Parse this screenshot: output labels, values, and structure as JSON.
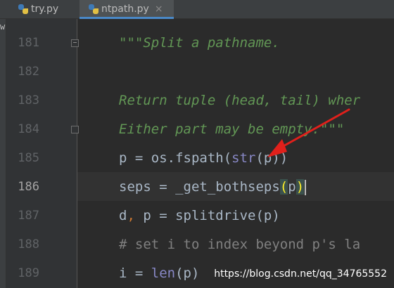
{
  "tabs": [
    {
      "label": "try.py",
      "active": false
    },
    {
      "label": "ntpath.py",
      "active": true,
      "close": "×"
    }
  ],
  "left_strip_label": "w",
  "lines": [
    {
      "num": "181",
      "tokens": [
        {
          "t": "\"\"\"Split a pathname.",
          "c": "doc"
        }
      ]
    },
    {
      "num": "182",
      "tokens": []
    },
    {
      "num": "183",
      "tokens": [
        {
          "t": "Return tuple (head, tail) wher",
          "c": "doc"
        }
      ]
    },
    {
      "num": "184",
      "tokens": [
        {
          "t": "Either part may be empty.\"\"\"",
          "c": "doc"
        }
      ]
    },
    {
      "num": "185",
      "tokens": [
        {
          "t": "p = os.fspath(",
          "c": ""
        },
        {
          "t": "str",
          "c": "builtin"
        },
        {
          "t": "(p))",
          "c": ""
        }
      ]
    },
    {
      "num": "186",
      "tokens": [
        {
          "t": "seps = _get_bothseps",
          "c": ""
        },
        {
          "t": "(",
          "c": "brkhl"
        },
        {
          "t": "p",
          "c": ""
        },
        {
          "t": ")",
          "c": "brkhl"
        }
      ]
    },
    {
      "num": "187",
      "tokens": [
        {
          "t": "d",
          "c": ""
        },
        {
          "t": ",",
          "c": "comma"
        },
        {
          "t": " p = splitdrive(p)",
          "c": ""
        }
      ]
    },
    {
      "num": "188",
      "tokens": [
        {
          "t": "# set i to index beyond p's la",
          "c": "cmt"
        }
      ]
    },
    {
      "num": "189",
      "tokens": [
        {
          "t": "i = ",
          "c": ""
        },
        {
          "t": "len",
          "c": "builtin"
        },
        {
          "t": "(p)",
          "c": ""
        }
      ]
    }
  ],
  "current_line": "186",
  "watermark": "https://blog.csdn.net/qq_34765552",
  "colors": {
    "background": "#2b2b2b",
    "gutter": "#313335",
    "docstring": "#629755",
    "comment": "#808080",
    "builtin": "#8888c6",
    "arrow": "#e0201b",
    "tab_accent": "#4a88c7"
  }
}
